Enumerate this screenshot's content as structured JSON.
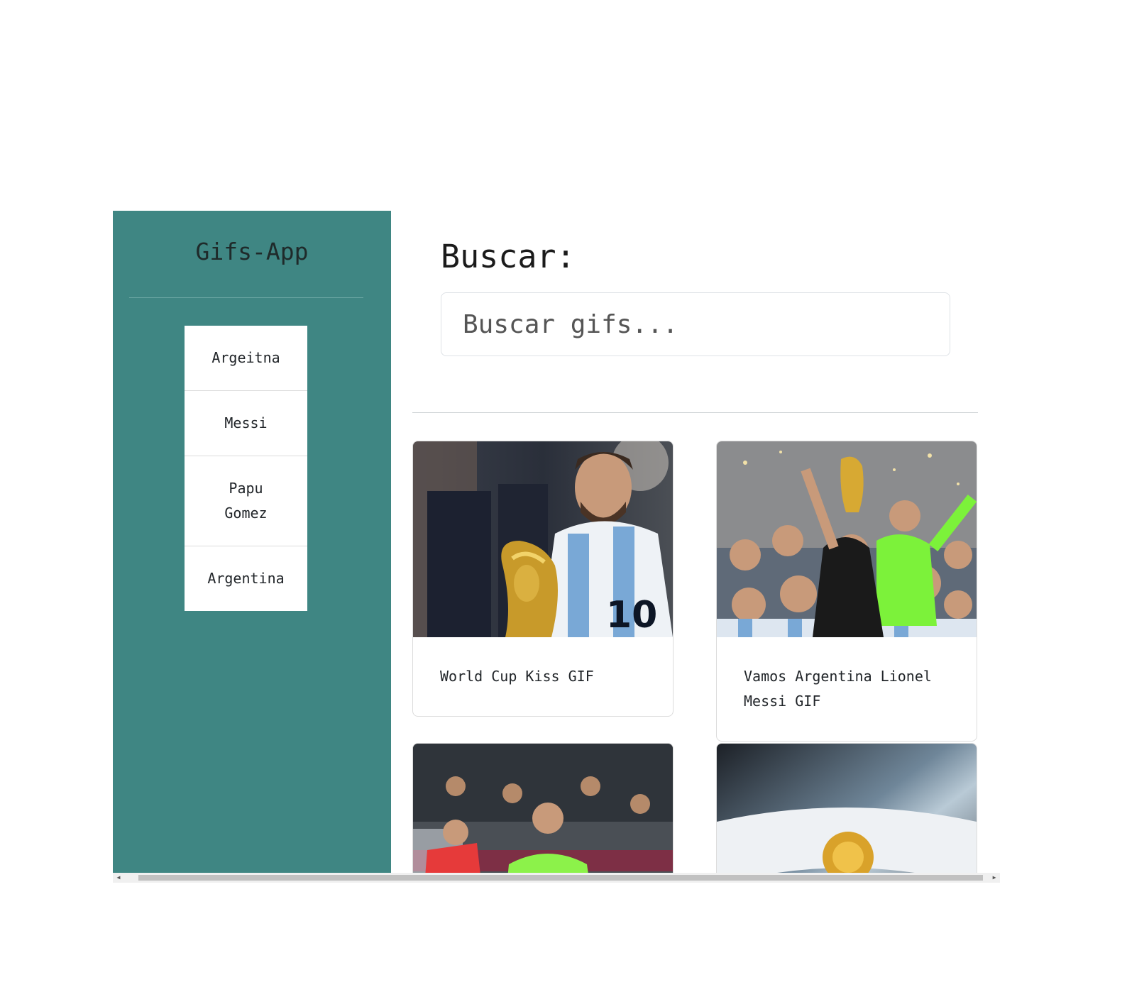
{
  "sidebar": {
    "title": "Gifs-App",
    "history": [
      {
        "label": "Argeitna"
      },
      {
        "label": "Messi"
      },
      {
        "label": "Papu Gomez"
      },
      {
        "label": "Argentina"
      }
    ]
  },
  "search": {
    "title": "Buscar:",
    "placeholder": "Buscar gifs..."
  },
  "gifs": [
    {
      "title": "World Cup Kiss GIF"
    },
    {
      "title": "Vamos Argentina Lionel Messi GIF"
    },
    {
      "title": ""
    },
    {
      "title": ""
    }
  ],
  "colors": {
    "sidebar_bg": "#3f8683",
    "card_border": "#dcdcdc"
  }
}
